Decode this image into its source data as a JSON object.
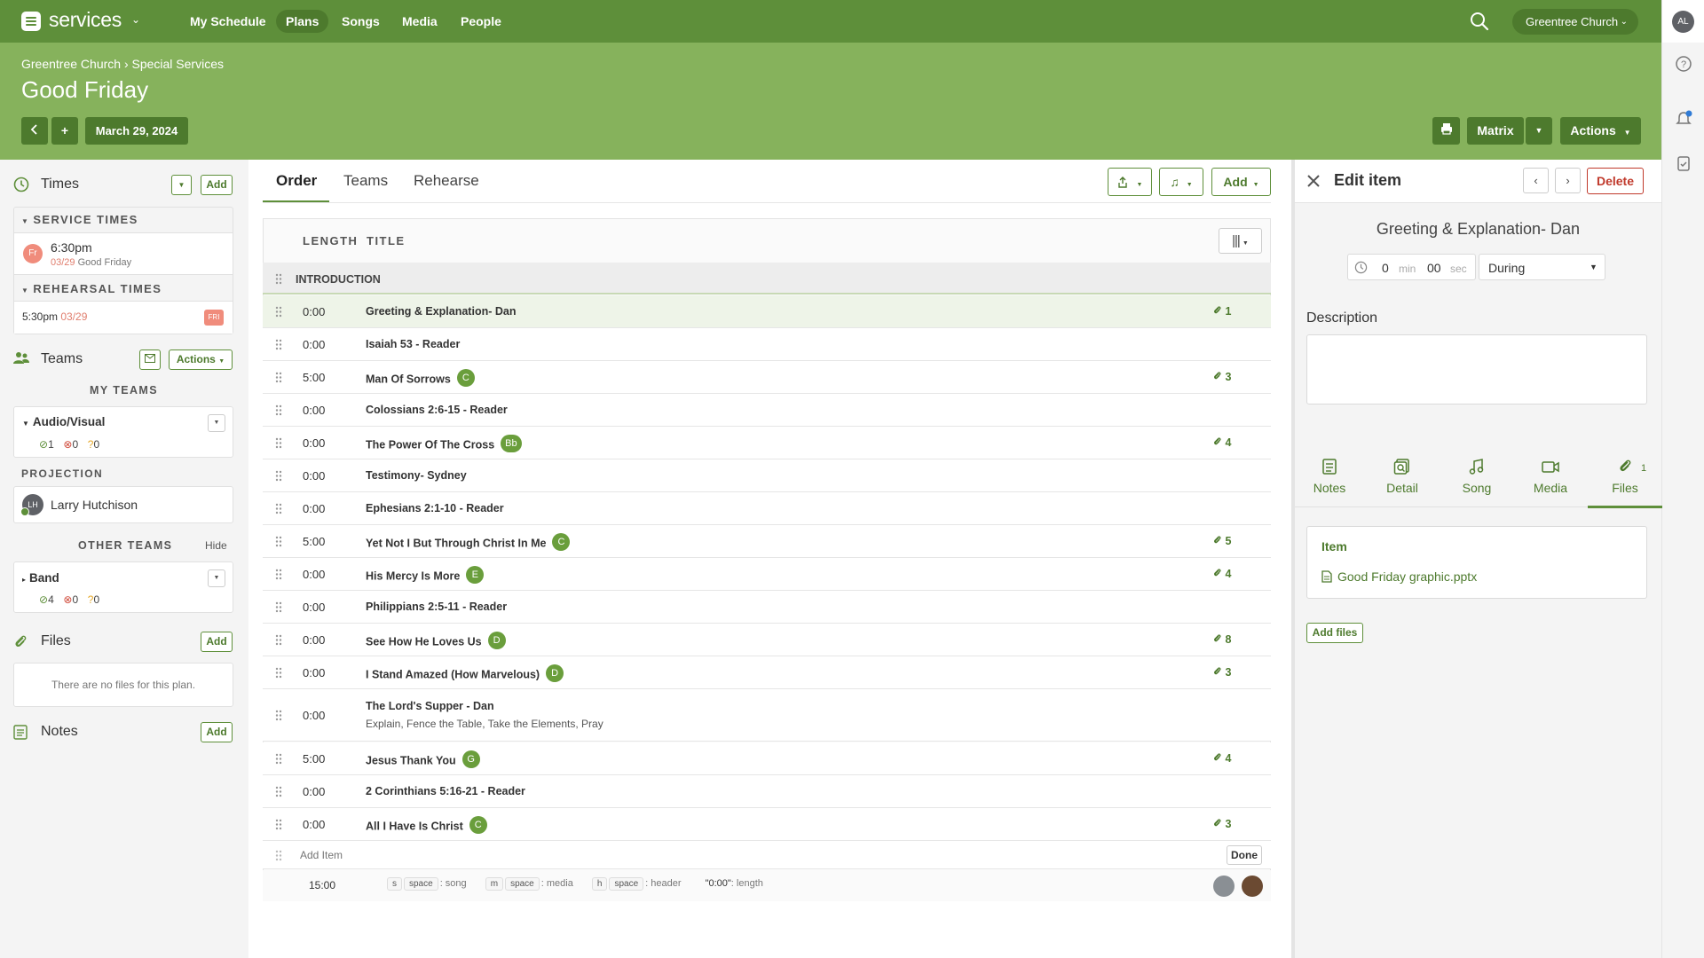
{
  "app": {
    "name": "services",
    "nav": [
      "My Schedule",
      "Plans",
      "Songs",
      "Media",
      "People"
    ],
    "active_nav": "Plans",
    "org": "Greentree Church",
    "user_initials": "AL"
  },
  "header": {
    "breadcrumb": "Greentree Church › Special Services",
    "title": "Good Friday",
    "date": "March 29, 2024",
    "buttons": {
      "matrix": "Matrix",
      "actions": "Actions"
    }
  },
  "times": {
    "title": "Times",
    "add": "Add",
    "service_times_label": "SERVICE TIMES",
    "service": {
      "day": "Fr",
      "time": "6:30pm",
      "date": "03/29",
      "name": "Good Friday"
    },
    "rehearsal_times_label": "REHEARSAL TIMES",
    "rehearsal": {
      "time": "5:30pm",
      "date": "03/29",
      "day": "FRI"
    }
  },
  "teams": {
    "title": "Teams",
    "actions": "Actions",
    "my_teams_label": "MY TEAMS",
    "my_team": {
      "name": "Audio/Visual",
      "confirmed": "1",
      "declined": "0",
      "pending": "0"
    },
    "position": "PROJECTION",
    "person": {
      "initials": "LH",
      "name": "Larry Hutchison"
    },
    "other_teams_label": "OTHER TEAMS",
    "hide": "Hide",
    "other_team": {
      "name": "Band",
      "confirmed": "4",
      "declined": "0",
      "pending": "0"
    }
  },
  "files": {
    "title": "Files",
    "add": "Add",
    "empty": "There are no files for this plan."
  },
  "notes": {
    "title": "Notes",
    "add": "Add"
  },
  "center": {
    "tabs": [
      "Order",
      "Teams",
      "Rehearse"
    ],
    "add": "Add",
    "col_length": "LENGTH",
    "col_title": "TITLE",
    "header_item": "INTRODUCTION",
    "items": [
      {
        "len": "0:00",
        "title": "Greeting & Explanation- Dan",
        "key": "",
        "files": "1"
      },
      {
        "len": "0:00",
        "title": "Isaiah 53 - Reader",
        "key": "",
        "files": ""
      },
      {
        "len": "5:00",
        "title": "Man Of Sorrows",
        "key": "C",
        "files": "3"
      },
      {
        "len": "0:00",
        "title": "Colossians 2:6-15 - Reader",
        "key": "",
        "files": ""
      },
      {
        "len": "0:00",
        "title": "The Power Of The Cross",
        "key": "Bb",
        "files": "4"
      },
      {
        "len": "0:00",
        "title": "Testimony- Sydney",
        "key": "",
        "files": ""
      },
      {
        "len": "0:00",
        "title": "Ephesians 2:1-10 - Reader",
        "key": "",
        "files": ""
      },
      {
        "len": "5:00",
        "title": "Yet Not I But Through Christ In Me",
        "key": "C",
        "files": "5"
      },
      {
        "len": "0:00",
        "title": "His Mercy Is More",
        "key": "E",
        "files": "4"
      },
      {
        "len": "0:00",
        "title": "Philippians 2:5-11 - Reader",
        "key": "",
        "files": ""
      },
      {
        "len": "0:00",
        "title": "See How He Loves Us",
        "key": "D",
        "files": "8"
      },
      {
        "len": "0:00",
        "title": "I Stand Amazed (How Marvelous)",
        "key": "D",
        "files": "3"
      },
      {
        "len": "0:00",
        "title": "The Lord's Supper - Dan",
        "key": "",
        "files": "",
        "sub": "Explain, Fence the Table, Take the Elements, Pray"
      },
      {
        "len": "5:00",
        "title": "Jesus Thank You",
        "key": "G",
        "files": "4"
      },
      {
        "len": "0:00",
        "title": "2 Corinthians 5:16-21 - Reader",
        "key": "",
        "files": ""
      },
      {
        "len": "0:00",
        "title": "All I Have Is Christ",
        "key": "C",
        "files": "3"
      }
    ],
    "add_item_placeholder": "Add Item",
    "done": "Done",
    "total": "15:00",
    "hints": {
      "s": "s",
      "m": "m",
      "h": "h",
      "space": "space",
      "song": ": song",
      "media": ": media",
      "header": ": header",
      "length_key": "\"0:00\"",
      "length": ": length"
    }
  },
  "edit": {
    "title": "Edit item",
    "delete": "Delete",
    "item_title": "Greeting & Explanation- Dan",
    "min": "0",
    "min_label": "min",
    "sec": "00",
    "sec_label": "sec",
    "timing": "During",
    "description_label": "Description",
    "tabs": [
      "Notes",
      "Detail",
      "Song",
      "Media",
      "Files"
    ],
    "files_count": "1",
    "item_label": "Item",
    "file_name": "Good Friday graphic.pptx",
    "add_files": "Add files"
  },
  "colors": {
    "brand": "#5e8f3a",
    "header": "#86b25c",
    "accent_dark": "#4d7a2d",
    "danger": "#c0392b"
  }
}
